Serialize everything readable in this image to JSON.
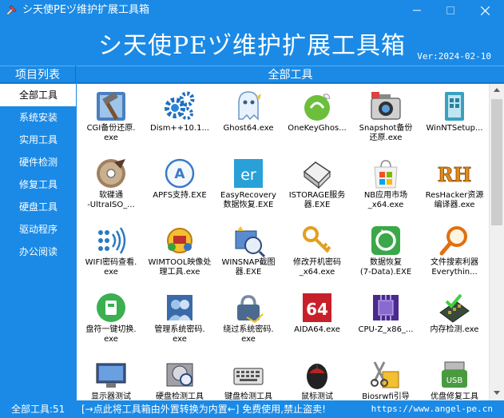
{
  "window": {
    "title": "シ天使PEヅ维护扩展工具箱"
  },
  "banner": {
    "title": "シ天使PEヅ维护扩展工具箱",
    "version": "Ver:2024-02-10"
  },
  "sidebar": {
    "header": "项目列表",
    "items": [
      {
        "label": "全部工具",
        "active": true
      },
      {
        "label": "系统安装"
      },
      {
        "label": "实用工具"
      },
      {
        "label": "硬件检测"
      },
      {
        "label": "修复工具"
      },
      {
        "label": "硬盘工具"
      },
      {
        "label": "驱动程序"
      },
      {
        "label": "办公阅读"
      }
    ]
  },
  "main": {
    "header": "全部工具",
    "tools": [
      {
        "label": "CGI备份还原.\nexe",
        "icon": "hammer-icon"
      },
      {
        "label": "Dism++10.1...",
        "icon": "gears-icon"
      },
      {
        "label": "Ghost64.exe",
        "icon": "ghost-icon"
      },
      {
        "label": "OneKeyGhos...",
        "icon": "onekey-ghost-icon"
      },
      {
        "label": "Snapshot备份\n还原.exe",
        "icon": "camera-icon"
      },
      {
        "label": "WinNTSetup...",
        "icon": "setup-icon"
      },
      {
        "label": "软碟通\n-UltraISO_...",
        "icon": "disc-icon"
      },
      {
        "label": "APFS支持.EXE",
        "icon": "apfs-icon"
      },
      {
        "label": "EasyRecovery\n数据恢复.EXE",
        "icon": "easyrecovery-icon"
      },
      {
        "label": "ISTORAGE服务\n器.EXE",
        "icon": "storage-icon"
      },
      {
        "label": "NB应用市场\n_x64.exe",
        "icon": "store-icon"
      },
      {
        "label": "ResHacker资源\n编译器.exe",
        "icon": "reshacker-icon"
      },
      {
        "label": "WIFI密码查看.\nexe",
        "icon": "wifi-icon"
      },
      {
        "label": "WIMTOOL映像处\n理工具.exe",
        "icon": "wimtool-icon"
      },
      {
        "label": "WINSNAP截图\n器.EXE",
        "icon": "winsnap-icon"
      },
      {
        "label": "修改开机密码\n_x64.exe",
        "icon": "key-icon"
      },
      {
        "label": "数据恢复\n(7-Data).EXE",
        "icon": "data-recovery-icon"
      },
      {
        "label": "文件搜索利器\nEverythin...",
        "icon": "search-icon"
      },
      {
        "label": "盘符一键切换.\nexe",
        "icon": "drive-switch-icon"
      },
      {
        "label": "管理系统密码.\nexe",
        "icon": "users-icon"
      },
      {
        "label": "绕过系统密码.\nexe",
        "icon": "bypass-icon"
      },
      {
        "label": "AIDA64.exe",
        "icon": "aida64-icon"
      },
      {
        "label": "CPU-Z_x86_...",
        "icon": "cpu-icon"
      },
      {
        "label": "内存检测.exe",
        "icon": "memory-icon"
      },
      {
        "label": "显示器测试",
        "icon": "monitor-icon"
      },
      {
        "label": "硬盘检测工具",
        "icon": "hdd-icon"
      },
      {
        "label": "键盘检测工具",
        "icon": "keyboard-icon"
      },
      {
        "label": "鼠标测试",
        "icon": "mouse-icon"
      },
      {
        "label": "Biosrwfi引导",
        "icon": "bios-icon"
      },
      {
        "label": "优盘修复工具",
        "icon": "usb-icon"
      }
    ]
  },
  "statusbar": {
    "count": "全部工具:51",
    "message": "[→点此将工具箱由外置转换为内置←] 免费使用,禁止盗卖!",
    "url": "https://www.angel-pe.cn"
  },
  "colors": {
    "accent": "#1a8ae6",
    "content_bg": "#ffffff"
  }
}
